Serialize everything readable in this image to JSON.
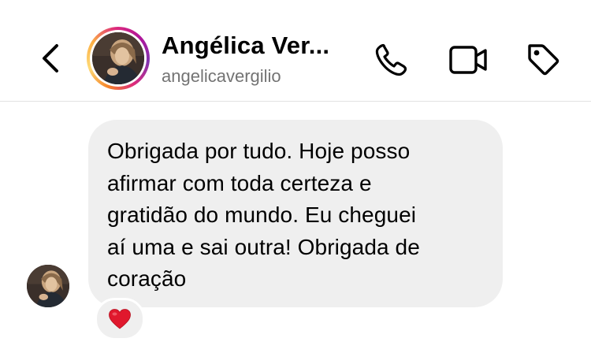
{
  "header": {
    "display_name": "Angélica Ver...",
    "username": "angelicavergilio",
    "icons": {
      "back": "chevron-left-icon",
      "call": "phone-icon",
      "video": "video-camera-icon",
      "tag": "tag-icon"
    },
    "story_ring": true
  },
  "conversation": {
    "messages": [
      {
        "sender": "Angélica Ver...",
        "text": "Obrigada por tudo. Hoje posso\nafirmar com toda certeza e\ngratidão do mundo. Eu cheguei\naí uma e sai outra! Obrigada de\ncoração",
        "reaction": "❤️"
      }
    ]
  },
  "colors": {
    "bubble_background": "#efefef",
    "username_gray": "#737373",
    "divider": "#e2e2e2",
    "reaction_heart": "#e0182d",
    "story_ring_gradient": [
      "#f58529",
      "#feda77",
      "#dd2a7b",
      "#8134af"
    ]
  }
}
